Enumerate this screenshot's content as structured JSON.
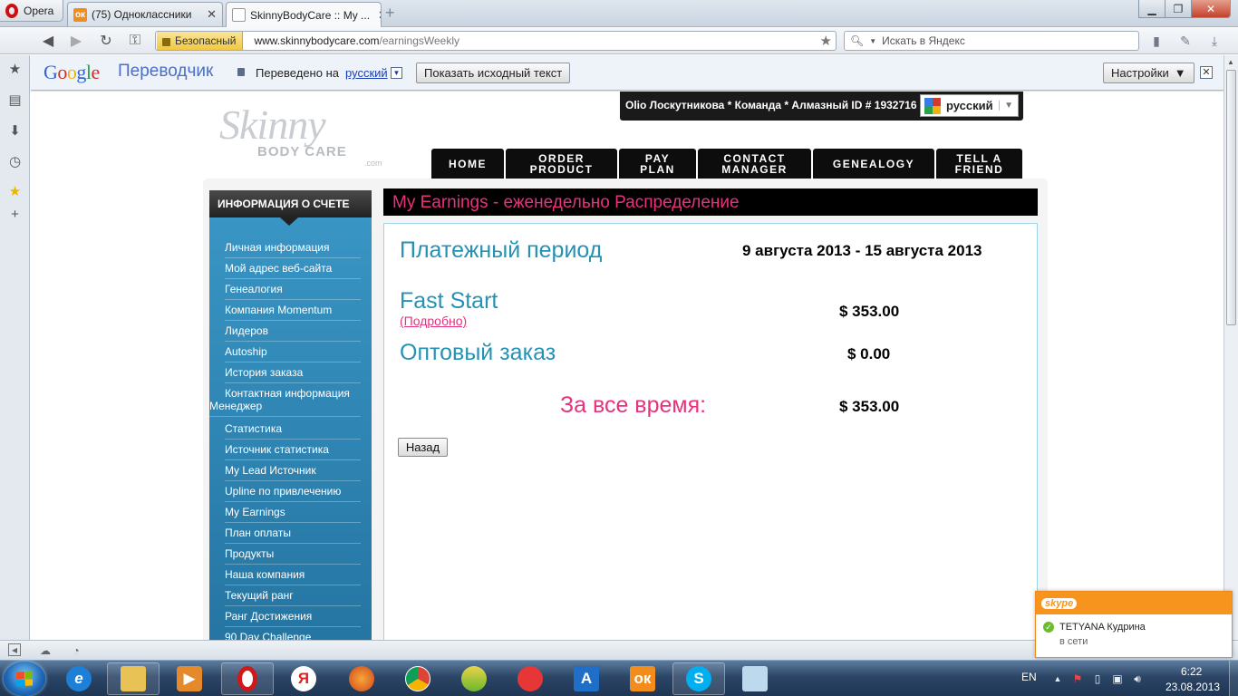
{
  "browser": {
    "opera_label": "Opera",
    "tabs": [
      {
        "label": "(75) Одноклассники",
        "close": "✕"
      },
      {
        "label": "SkinnyBodyCare :: My ...",
        "close": "✕"
      }
    ],
    "new_tab": "+",
    "secure_label": "Безопасный",
    "url_host": "www.skinnybodycare.com",
    "url_path": "/earningsWeekly",
    "search_placeholder": "Искать в Яндекс"
  },
  "translate_bar": {
    "logo_letters": [
      "G",
      "o",
      "o",
      "g",
      "l",
      "e"
    ],
    "title": "Переводчик",
    "translated_to": "Переведено на",
    "language": "русский",
    "show_original": "Показать исходный текст",
    "settings": "Настройки",
    "settings_caret": "▼",
    "close": "✕"
  },
  "site": {
    "logo_script": "Skinny",
    "logo_body": "BODY CARE",
    "logo_com": ".com",
    "user_info": "Olio Лоскутникова * Команда * Алмазный ID # 1932716",
    "lang_selector": "русский",
    "nav": [
      {
        "label": "HOME",
        "width": 80
      },
      {
        "label": "ORDER\nPRODUCT",
        "width": 123
      },
      {
        "label": "PAY\nPLAN",
        "width": 85
      },
      {
        "label": "CONTACT\nMANAGER",
        "width": 125
      },
      {
        "label": "GENEALOGY",
        "width": 134
      },
      {
        "label": "TELL A\nFRIEND",
        "width": 95
      }
    ]
  },
  "sidebar": {
    "header": "ИНФОРМАЦИЯ О СЧЕТЕ",
    "items": [
      "Личная информация",
      "Мой адрес веб-сайта",
      "Генеалогия",
      "Компания Momentum",
      "Лидеров",
      "Autoship",
      "История заказа",
      "Контактная информация Менеджер",
      "Статистика",
      "Источник статистика",
      "My Lead Источник",
      "Upline по привлечению",
      "My Earnings",
      "План оплаты",
      "Продукты",
      "Наша компания",
      "Текущий ранг",
      "Ранг Достижения",
      "90 Day Challenge"
    ]
  },
  "earnings": {
    "title": "My Earnings - еженедельно Распределение",
    "period_label": "Платежный период",
    "period_value": "9 августа 2013 - 15 августа 2013",
    "fast_start_label": "Fast Start",
    "fast_start_detail": "(Подробно)",
    "fast_start_value": "$ 353.00",
    "wholesale_label": "Оптовый заказ",
    "wholesale_value": "$ 0.00",
    "total_label": "За все время:",
    "total_value": "$ 353.00",
    "back_button": "Назад"
  },
  "skype_popup": {
    "logo": "skype",
    "contact": "TETYANA Кудрина",
    "status": "в сети"
  },
  "taskbar": {
    "language": "EN",
    "time": "6:22",
    "date": "23.08.2013"
  }
}
